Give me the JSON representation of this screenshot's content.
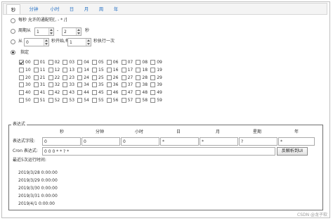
{
  "tabs": [
    "秒",
    "分钟",
    "小时",
    "日",
    "月",
    "周",
    "年"
  ],
  "second": {
    "every_label": "每秒 允许的通配符[, - * /]",
    "cycle_prefix": "周期从",
    "cycle_from": "1",
    "cycle_dash": "-",
    "cycle_to": "2",
    "cycle_suffix": "秒",
    "from_prefix": "从",
    "from_start": "0",
    "from_mid": "秒开始,每",
    "from_step": "1",
    "from_suffix": "秒执行一次",
    "specify_label": "指定",
    "numbers": [
      "00",
      "01",
      "02",
      "03",
      "04",
      "05",
      "06",
      "07",
      "08",
      "09",
      "10",
      "11",
      "12",
      "13",
      "14",
      "15",
      "16",
      "17",
      "18",
      "19",
      "20",
      "21",
      "22",
      "23",
      "24",
      "25",
      "26",
      "27",
      "28",
      "29",
      "30",
      "31",
      "32",
      "33",
      "34",
      "35",
      "36",
      "37",
      "38",
      "39",
      "40",
      "41",
      "42",
      "43",
      "44",
      "45",
      "46",
      "47",
      "48",
      "49",
      "50",
      "51",
      "52",
      "53",
      "54",
      "55",
      "56",
      "57",
      "58",
      "59"
    ],
    "checked": [
      "00"
    ]
  },
  "expression": {
    "legend": "表达式",
    "columns": [
      "秒",
      "分钟",
      "小时",
      "日",
      "月",
      "星期",
      "年"
    ],
    "field_label": "表达式字段:",
    "fields": [
      "0",
      "0",
      "0",
      "*",
      "*",
      "?",
      "*"
    ],
    "cron_label": "Cron 表达式:",
    "cron_value": "0 0 0 * * ? *",
    "parse_button": "反解析到UI",
    "recent_label": "最近5次运行时间:",
    "runs": [
      "2019/3/28 0:00:00",
      "2019/3/29 0:00:00",
      "2019/3/30 0:00:00",
      "2019/3/31 0:00:00",
      "2019/4/1 0:00:00"
    ]
  },
  "watermark": "CSDN @龙子软"
}
